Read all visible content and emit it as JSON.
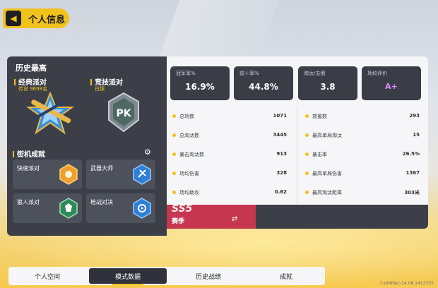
{
  "header": {
    "title": "个人信息"
  },
  "history": {
    "title": "历史最高",
    "modes": [
      {
        "name": "经典派对",
        "rank": "传说 9698名"
      },
      {
        "name": "竞技派对",
        "rank": "白银"
      }
    ],
    "arcade_title": "街机成就",
    "achievements": [
      {
        "label": "快速派对"
      },
      {
        "label": "武器大师"
      },
      {
        "label": "狼人派对"
      },
      {
        "label": "枪战对决"
      }
    ]
  },
  "stats": {
    "cards": [
      {
        "label": "冠军率%",
        "value": "16.9%"
      },
      {
        "label": "前十率%",
        "value": "44.8%"
      },
      {
        "label": "淘汰/击倒",
        "value": "3.8"
      },
      {
        "label": "场均评价",
        "value": "A+"
      }
    ],
    "left_rows": [
      {
        "label": "总场数",
        "value": "1071"
      },
      {
        "label": "总淘汰数",
        "value": "3445"
      },
      {
        "label": "暴击淘汰数",
        "value": "913"
      },
      {
        "label": "场均伤害",
        "value": "328"
      },
      {
        "label": "场均助攻",
        "value": "0.62"
      }
    ],
    "right_rows": [
      {
        "label": "救援数",
        "value": "293"
      },
      {
        "label": "最高单局淘汰",
        "value": "15"
      },
      {
        "label": "暴击率",
        "value": "26.5%"
      },
      {
        "label": "最高单局伤害",
        "value": "1367"
      },
      {
        "label": "最高淘汰距离",
        "value": "303米"
      }
    ]
  },
  "season": {
    "code": "SS5",
    "label": "赛季"
  },
  "tabs": [
    "个人空间",
    "模式数据",
    "历史战绩",
    "成就"
  ],
  "build": "1-d069ac-14.08.1413325"
}
